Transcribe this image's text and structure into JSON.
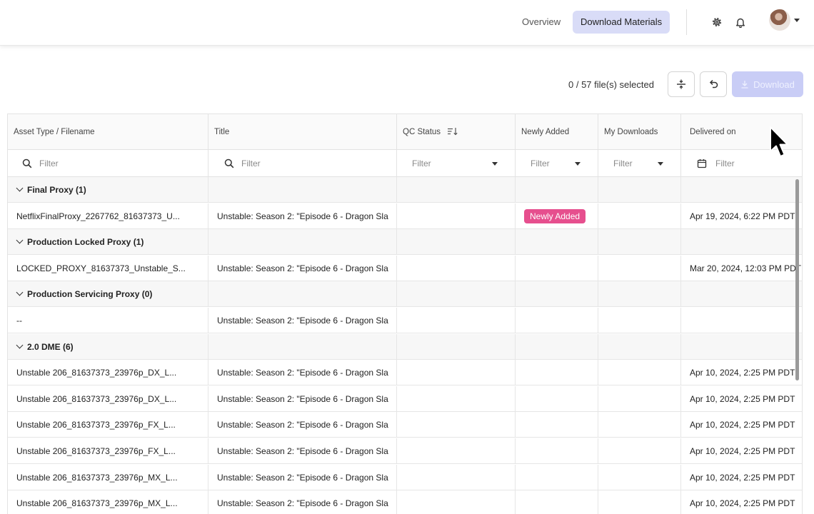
{
  "nav": {
    "overview": "Overview",
    "download_materials": "Download Materials"
  },
  "icons": {
    "settings": "gear-icon",
    "notifications": "bell-icon",
    "avatar": "avatar"
  },
  "toolbar": {
    "selection": "0 / 57 file(s) selected",
    "download_label": "Download"
  },
  "columns": {
    "asset": "Asset Type / Filename",
    "title": "Title",
    "qc": "QC Status",
    "newly": "Newly Added",
    "mydl": "My Downloads",
    "delivered": "Delivered on"
  },
  "filters": {
    "asset": "Filter",
    "title": "Filter",
    "qc": "Filter",
    "newly": "Filter",
    "mydl": "Filter",
    "delivered": "Filter"
  },
  "rows": [
    {
      "type": "group",
      "label": "Final Proxy (1)"
    },
    {
      "type": "item",
      "asset": "NetflixFinalProxy_2267762_81637373_U...",
      "title": "Unstable: Season 2: \"Episode 6 - Dragon Sla",
      "newly": "Newly Added",
      "delivered": "Apr 19, 2024, 6:22 PM PDT"
    },
    {
      "type": "group",
      "label": "Production Locked Proxy (1)"
    },
    {
      "type": "item",
      "asset": "LOCKED_PROXY_81637373_Unstable_S...",
      "title": "Unstable: Season 2: \"Episode 6 - Dragon Sla",
      "newly": "",
      "delivered": "Mar 20, 2024, 12:03 PM PDT"
    },
    {
      "type": "group",
      "label": "Production Servicing Proxy (0)"
    },
    {
      "type": "item",
      "asset": "--",
      "title": "Unstable: Season 2: \"Episode 6 - Dragon Sla",
      "newly": "",
      "delivered": ""
    },
    {
      "type": "group",
      "label": "2.0 DME (6)"
    },
    {
      "type": "item",
      "asset": "Unstable 206_81637373_23976p_DX_L...",
      "title": "Unstable: Season 2: \"Episode 6 - Dragon Sla",
      "newly": "",
      "delivered": "Apr 10, 2024, 2:25 PM PDT"
    },
    {
      "type": "item",
      "asset": "Unstable 206_81637373_23976p_DX_L...",
      "title": "Unstable: Season 2: \"Episode 6 - Dragon Sla",
      "newly": "",
      "delivered": "Apr 10, 2024, 2:25 PM PDT"
    },
    {
      "type": "item",
      "asset": "Unstable 206_81637373_23976p_FX_L...",
      "title": "Unstable: Season 2: \"Episode 6 - Dragon Sla",
      "newly": "",
      "delivered": "Apr 10, 2024, 2:25 PM PDT"
    },
    {
      "type": "item",
      "asset": "Unstable 206_81637373_23976p_FX_L...",
      "title": "Unstable: Season 2: \"Episode 6 - Dragon Sla",
      "newly": "",
      "delivered": "Apr 10, 2024, 2:25 PM PDT"
    },
    {
      "type": "item",
      "asset": "Unstable 206_81637373_23976p_MX_L...",
      "title": "Unstable: Season 2: \"Episode 6 - Dragon Sla",
      "newly": "",
      "delivered": "Apr 10, 2024, 2:25 PM PDT"
    },
    {
      "type": "item",
      "asset": "Unstable 206_81637373_23976p_MX_L...",
      "title": "Unstable: Season 2: \"Episode 6 - Dragon Sla",
      "newly": "",
      "delivered": "Apr 10, 2024, 2:25 PM PDT"
    }
  ]
}
